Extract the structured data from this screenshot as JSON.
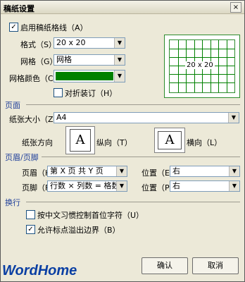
{
  "window": {
    "title": "稿纸设置",
    "close_glyph": "×"
  },
  "enable": {
    "checked_glyph": "✓",
    "label": "启用稿纸格线（A）"
  },
  "format": {
    "label": "格式（S）",
    "value": "20 x 20"
  },
  "grid": {
    "label": "网格（G）",
    "value": "网格"
  },
  "grid_color": {
    "label": "网格颜色（C）",
    "color": "#008000"
  },
  "fold": {
    "label": "对折装订（H）"
  },
  "preview": {
    "text": "20 x 20"
  },
  "page_section": {
    "title": "页面"
  },
  "paper_size": {
    "label": "纸张大小（Z）",
    "value": "A4"
  },
  "orientation": {
    "label": "纸张方向",
    "portrait_label": "纵向（T）",
    "landscape_label": "横向（L）",
    "glyph": "A"
  },
  "header_footer_section": {
    "title": "页眉/页脚"
  },
  "header": {
    "label": "页眉（H）",
    "value": "第 X 页 共 Y 页",
    "pos_label": "位置（E）",
    "pos_value": "右"
  },
  "footer": {
    "label": "页脚（F）",
    "value": "行数 × 列数 = 格数",
    "pos_label": "位置（P）",
    "pos_value": "右"
  },
  "wrap_section": {
    "title": "换行"
  },
  "chinese_control": {
    "label": "按中文习惯控制首位字符（U）"
  },
  "punct_overflow": {
    "checked_glyph": "✓",
    "label": "允许标点溢出边界（B）"
  },
  "buttons": {
    "ok": "确认",
    "cancel": "取消"
  },
  "logo": {
    "text": "WordHome"
  },
  "icons": {
    "dropdown_glyph": "▼"
  }
}
